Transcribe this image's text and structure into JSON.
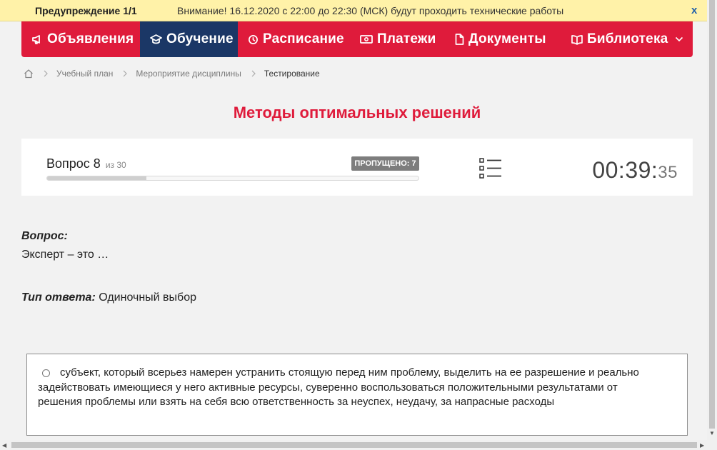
{
  "warning": {
    "title": "Предупреждение 1/1",
    "text": "Внимание! 16.12.2020 с 22:00 до 22:30 (МСК) будут проходить технические работы",
    "close": "x"
  },
  "nav": {
    "items": [
      {
        "label": "Объявления",
        "icon": "megaphone-icon"
      },
      {
        "label": "Обучение",
        "icon": "graduation-cap-icon",
        "active": true
      },
      {
        "label": "Расписание",
        "icon": "clock-icon"
      },
      {
        "label": "Платежи",
        "icon": "money-icon"
      },
      {
        "label": "Документы",
        "icon": "document-icon"
      },
      {
        "label": "Библиотека",
        "icon": "book-icon",
        "dropdown": true
      }
    ]
  },
  "breadcrumb": {
    "home_icon": "home-icon",
    "items": [
      "Учебный план",
      "Мероприятие дисциплины",
      "Тестирование"
    ]
  },
  "page": {
    "title": "Методы оптимальных решений"
  },
  "question_header": {
    "label": "Вопрос 8",
    "of": "из 30",
    "progress": 0.267,
    "skipped": "ПРОПУЩЕНО: 7",
    "list_icon": "list-icon",
    "timer_main": "00:39:",
    "timer_seconds": "35"
  },
  "question": {
    "label": "Вопрос:",
    "text": "Эксперт – это …",
    "answer_type_label": "Тип ответа:",
    "answer_type_value": "Одиночный выбор"
  },
  "answers": [
    {
      "text": "субъект, который всерьез намерен устранить стоящую перед ним проблему, выделить на ее разрешение и реально задействовать имеющиеся у него активные ресурсы, суверенно воспользоваться положительными результатами от решения проблемы или взять на себя всю ответственность за неуспех, неудачу, за напрасные расходы",
      "selected": false
    }
  ],
  "colors": {
    "accent": "#df1b3b",
    "nav_active": "#1b3766",
    "warning_bg": "#fff2a8"
  }
}
